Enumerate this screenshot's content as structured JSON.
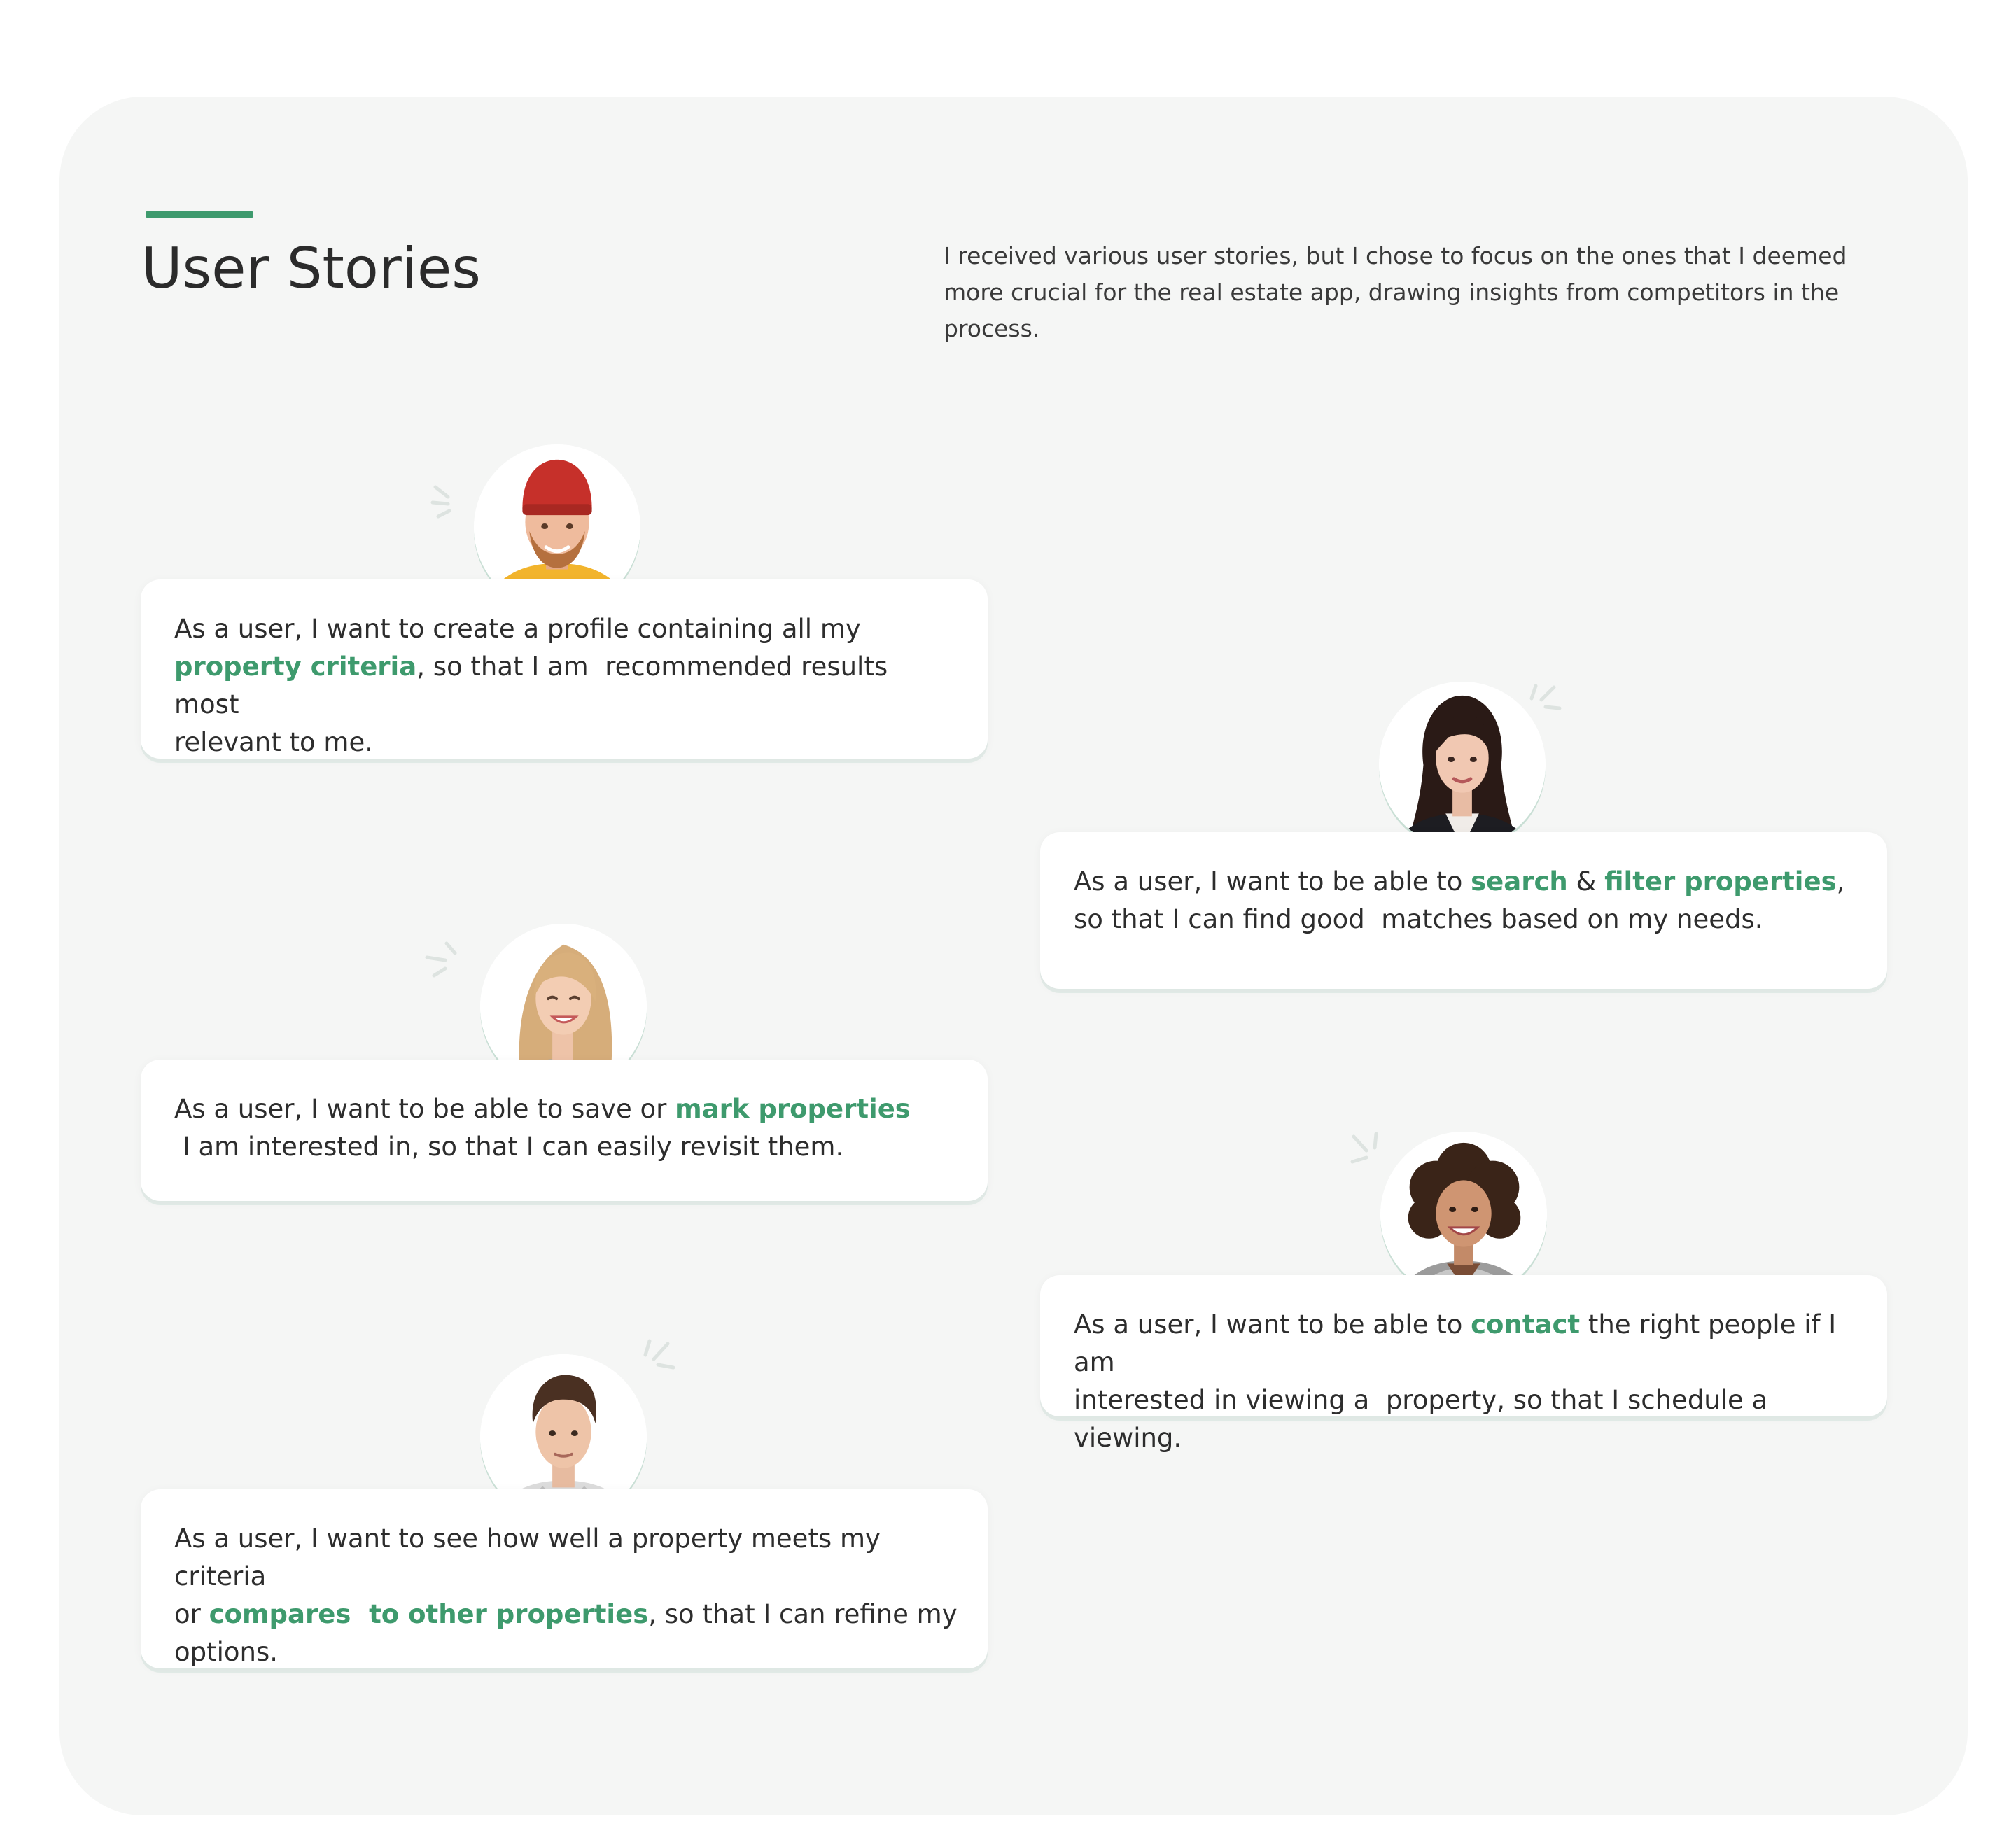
{
  "header": {
    "title": "User Stories",
    "intro": "I received various user stories, but I chose to focus on the ones that I deemed more crucial for the real estate app, drawing insights from competitors in the process."
  },
  "colors": {
    "accent": "#3e9a6d",
    "panel_bg": "#f5f6f5",
    "card_bg": "#ffffff",
    "text": "#2d2d2d"
  },
  "stories": [
    {
      "avatar": "man-red-beanie-portrait",
      "parts": [
        {
          "text": "As a user, I want to create a profile containing all my\n",
          "hl": false
        },
        {
          "text": "property criteria",
          "hl": true
        },
        {
          "text": ", so that I am  recommended results most\nrelevant to me.",
          "hl": false
        }
      ]
    },
    {
      "avatar": "woman-dark-hair-portrait",
      "parts": [
        {
          "text": "As a user, I want to be able to ",
          "hl": false
        },
        {
          "text": "search",
          "hl": true
        },
        {
          "text": " & ",
          "hl": false
        },
        {
          "text": "filter properties",
          "hl": true
        },
        {
          "text": ",\nso that I can find good  matches based on my needs.",
          "hl": false
        }
      ]
    },
    {
      "avatar": "woman-blonde-portrait",
      "parts": [
        {
          "text": "As a user, I want to be able to save or ",
          "hl": false
        },
        {
          "text": "mark properties",
          "hl": true
        },
        {
          "text": "\n I am interested in, so that I can easily revisit them.",
          "hl": false
        }
      ]
    },
    {
      "avatar": "woman-curly-hair-portrait",
      "parts": [
        {
          "text": "As a user, I want to be able to ",
          "hl": false
        },
        {
          "text": "contact",
          "hl": true
        },
        {
          "text": " the right people if I am\ninterested in viewing a  property, so that I schedule a viewing.",
          "hl": false
        }
      ]
    },
    {
      "avatar": "man-brown-hair-portrait",
      "parts": [
        {
          "text": "As a user, I want to see how well a property meets my criteria\nor ",
          "hl": false
        },
        {
          "text": "compares  to other properties",
          "hl": true
        },
        {
          "text": ", so that I can refine my\noptions.",
          "hl": false
        }
      ]
    }
  ]
}
